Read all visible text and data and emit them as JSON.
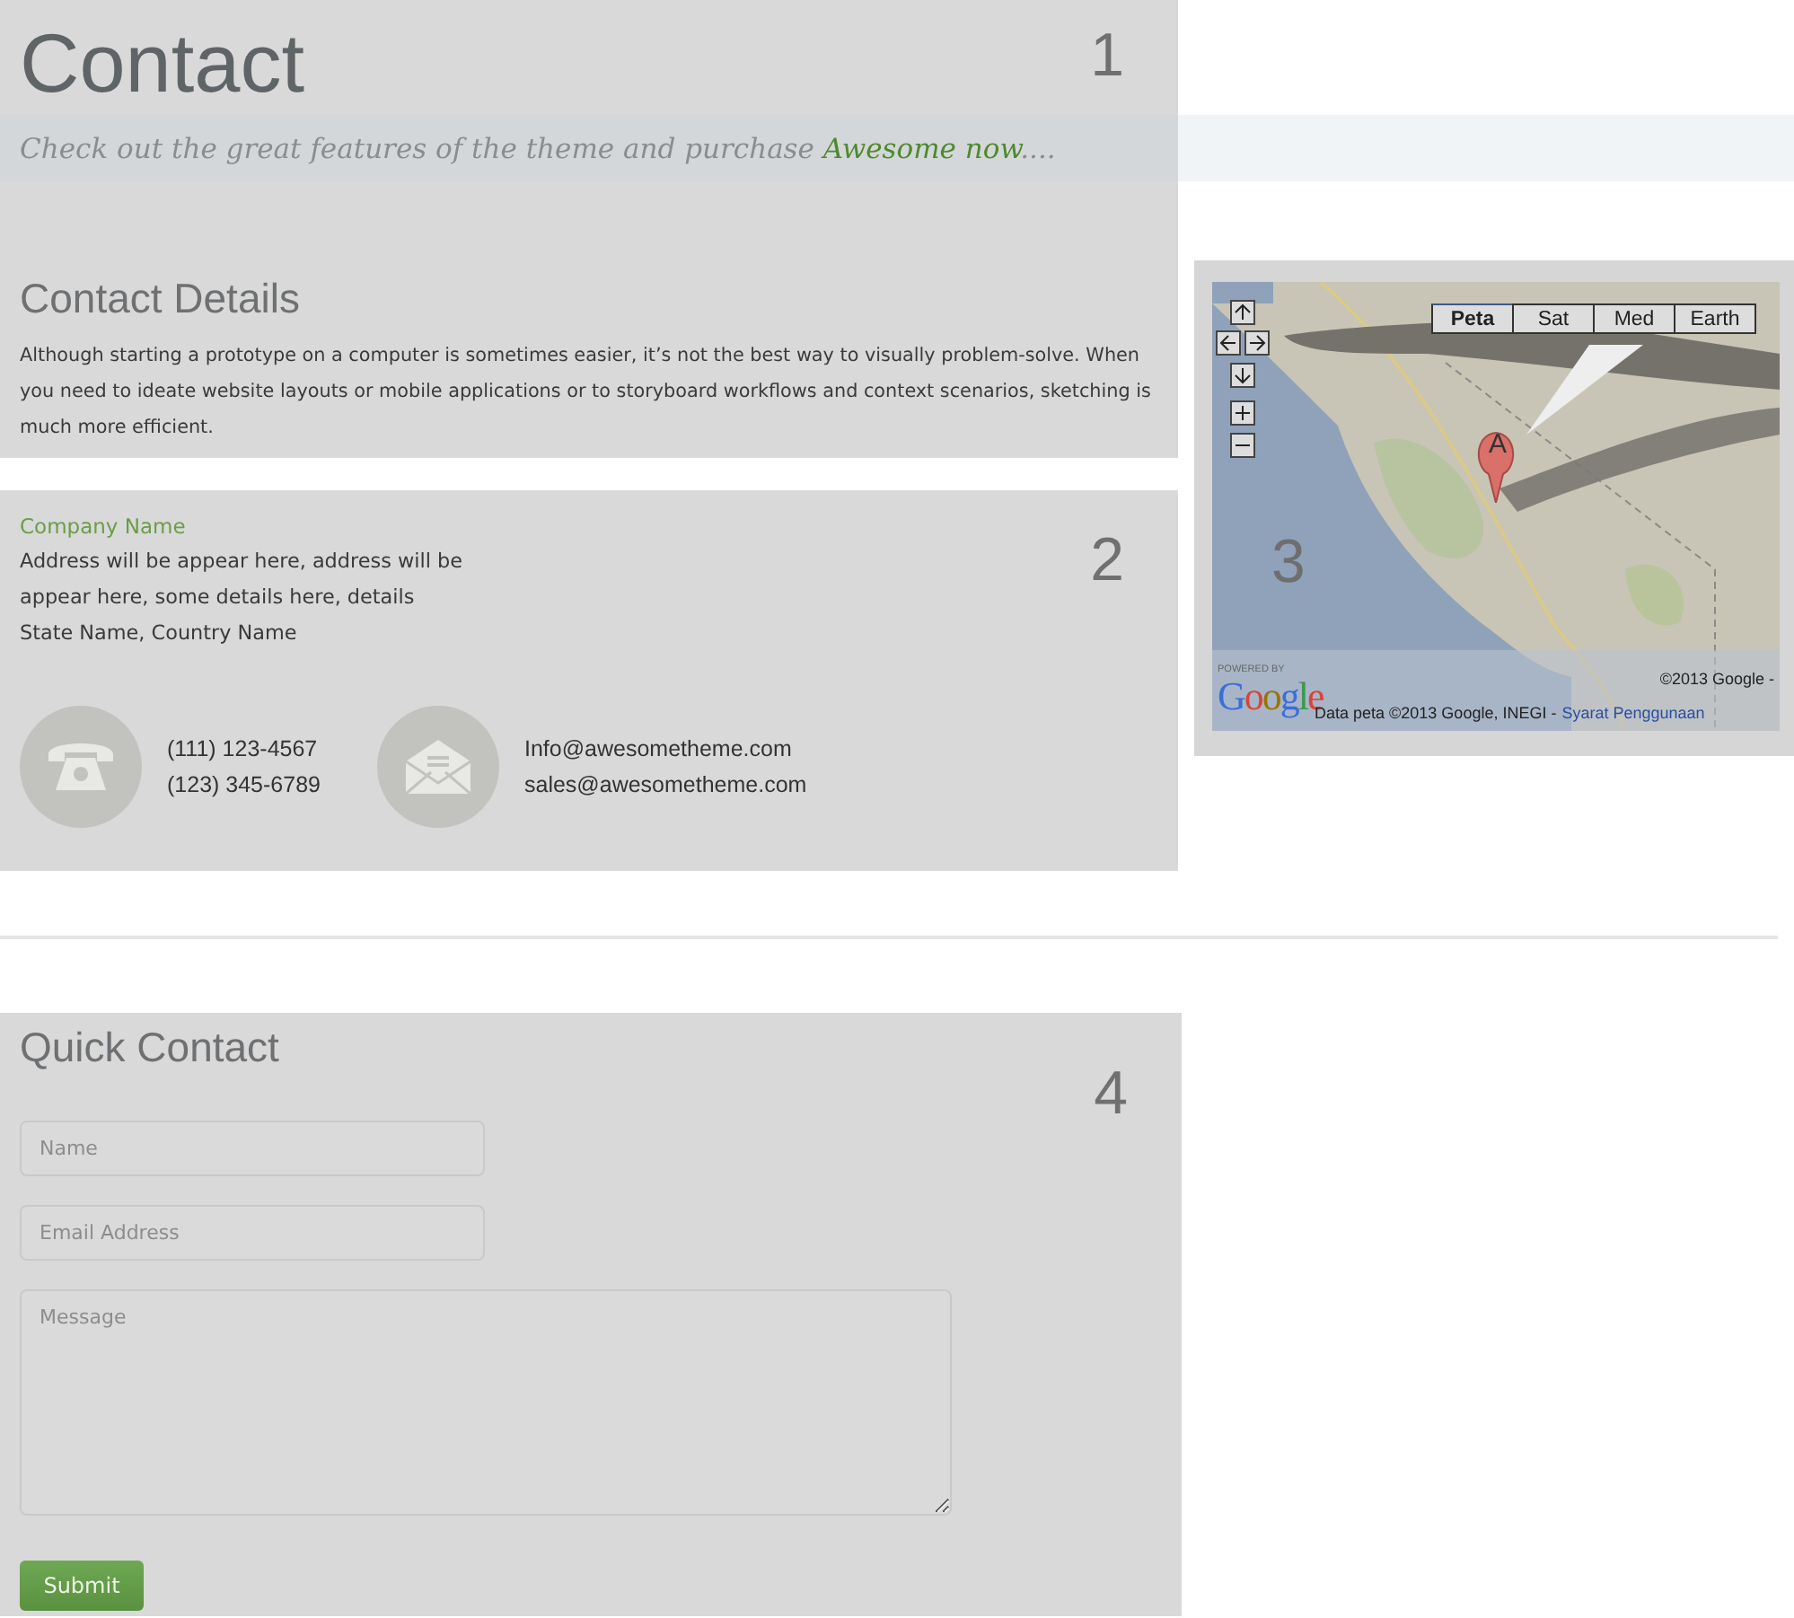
{
  "header": {
    "title": "Contact",
    "number": "1"
  },
  "banner": {
    "segments": [
      {
        "kind": "plain",
        "text": "Check out the great features of the theme and purchase "
      },
      {
        "kind": "link",
        "text": "Awesome now"
      },
      {
        "kind": "plain",
        "text": "...."
      }
    ]
  },
  "details": {
    "heading": "Contact Details",
    "paragraph": "Although starting a prototype on a computer is sometimes easier, it’s not the best way to visually problem-solve. When you need to ideate website layouts or mobile applications or to storyboard workflows and context scenarios, sketching is much more efficient."
  },
  "address_block": {
    "number": "2",
    "company": "Company Name",
    "lines": [
      "Address will be appear here, address will be",
      "appear here, some details here, details",
      "State Name, Country Name"
    ],
    "contacts": [
      {
        "kind": "phone",
        "lines": [
          "(111) 123-4567",
          "(123) 345-6789"
        ]
      },
      {
        "kind": "email",
        "lines": [
          "Info@awesometheme.com",
          "sales@awesometheme.com"
        ]
      }
    ]
  },
  "map": {
    "number": "3",
    "marker": "A",
    "map_types": [
      {
        "label": "Peta",
        "selected": true
      },
      {
        "label": "Sat",
        "selected": false
      },
      {
        "label": "Med",
        "selected": false
      },
      {
        "label": "Earth",
        "selected": false
      }
    ],
    "powered_by": "POWERED BY",
    "logo": "Google",
    "copyright": "©2013 Google -",
    "attribution": "Data peta ©2013 Google, INEGI -",
    "terms_link": "Syarat Penggunaan"
  },
  "quick_contact": {
    "heading": "Quick Contact",
    "number": "4",
    "fields": [
      {
        "kind": "input",
        "placeholder": "Name"
      },
      {
        "kind": "input",
        "placeholder": "Email Address"
      },
      {
        "kind": "textarea",
        "placeholder": "Message"
      }
    ],
    "submit": "Submit"
  }
}
